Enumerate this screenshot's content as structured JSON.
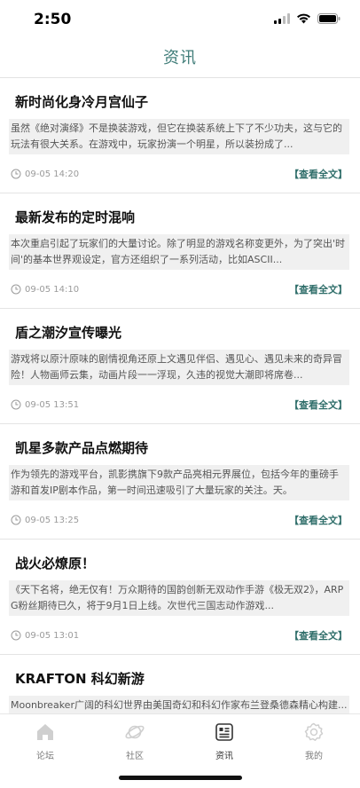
{
  "status_bar": {
    "time": "2:50"
  },
  "nav": {
    "title": "资讯"
  },
  "articles": [
    {
      "title": "新时尚化身冷月宫仙子",
      "summary": "虽然《绝对演绎》不是换装游戏，但它在换装系统上下了不少功夫，这与它的玩法有很大关系。在游戏中，玩家扮演一个明星，所以装扮成了...",
      "time": "09-05 14:20",
      "link": "【查看全文】"
    },
    {
      "title": "最新发布的定时混响",
      "summary": "本次重启引起了玩家们的大量讨论。除了明显的游戏名称变更外，为了突出'时间'的基本世界观设定，官方还组织了一系列活动，比如ASCII...",
      "time": "09-05 14:10",
      "link": "【查看全文】"
    },
    {
      "title": "盾之潮汐宣传曝光",
      "summary": "游戏将以原汁原味的剧情视角还原上文遇见伴侣、遇见心、遇见未来的奇异冒险！人物画师云集，动画片段一一浮现，久违的视觉大潮即将席卷...",
      "time": "09-05 13:51",
      "link": "【查看全文】"
    },
    {
      "title": "凯星多款产品点燃期待",
      "summary": "作为领先的游戏平台，凯影携旗下9款产品亮相元界展位，包括今年的重磅手游和首发IP剧本作品，第一时间迅速吸引了大量玩家的关注。天。",
      "time": "09-05 13:25",
      "link": "【查看全文】"
    },
    {
      "title": "战火必燎原！",
      "summary": "《天下名将，绝无仅有！万众期待的国韵创新无双动作手游《极无双2》，ARPG粉丝期待已久，将于9月1日上线。次世代三国志动作游戏...",
      "time": "09-05 13:01",
      "link": "【查看全文】"
    },
    {
      "title": "KRAFTON 科幻新游",
      "summary": "Moonbreaker广阔的科幻世界由美国奇幻和科幻作家布兰登桑德森精心构建...",
      "time": "",
      "link": ""
    }
  ],
  "tabs": [
    {
      "label": "论坛",
      "icon": "forum-icon"
    },
    {
      "label": "社区",
      "icon": "planet-icon"
    },
    {
      "label": "资讯",
      "icon": "news-icon"
    },
    {
      "label": "我的",
      "icon": "gear-icon"
    }
  ],
  "colors": {
    "accent": "#3f7c78",
    "link": "#2f6e6a",
    "summary_bg": "#f0f0f0"
  }
}
